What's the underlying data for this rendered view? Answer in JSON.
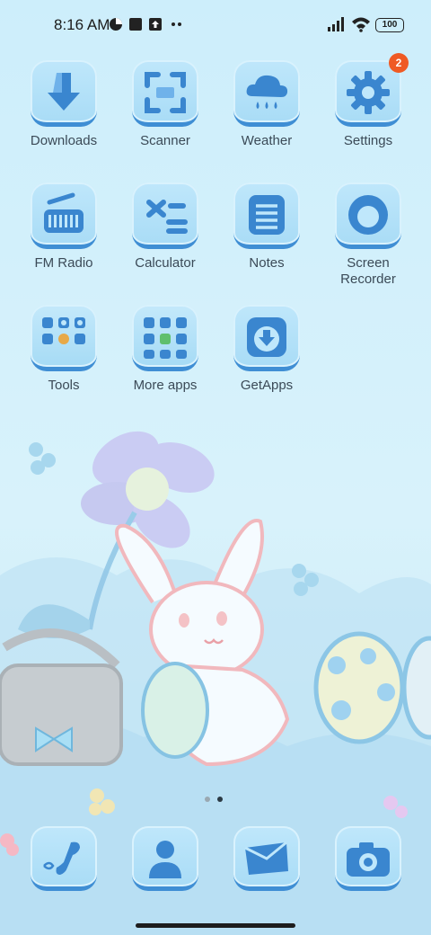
{
  "status_bar": {
    "time": "8:16 AM",
    "battery": "100",
    "icons": [
      "data-saver-icon",
      "square-notification-icon",
      "upload-notification-icon",
      "more-notifications-icon",
      "signal-icon",
      "wifi-icon",
      "battery-icon"
    ]
  },
  "apps": [
    {
      "label": "Downloads",
      "icon": "download-icon"
    },
    {
      "label": "Scanner",
      "icon": "scanner-icon"
    },
    {
      "label": "Weather",
      "icon": "weather-icon"
    },
    {
      "label": "Settings",
      "icon": "gear-icon",
      "badge": "2"
    },
    {
      "label": "FM Radio",
      "icon": "radio-icon"
    },
    {
      "label": "Calculator",
      "icon": "calculator-icon"
    },
    {
      "label": "Notes",
      "icon": "notes-icon"
    },
    {
      "label": "Screen\nRecorder",
      "icon": "screen-recorder-icon"
    },
    {
      "label": "Tools",
      "icon": "folder-icon"
    },
    {
      "label": "More apps",
      "icon": "folder-icon"
    },
    {
      "label": "GetApps",
      "icon": "getapps-icon"
    }
  ],
  "page_indicator": {
    "pages": 2,
    "current": 2
  },
  "dock": [
    {
      "icon": "phone-icon"
    },
    {
      "icon": "contacts-icon"
    },
    {
      "icon": "messages-icon"
    },
    {
      "icon": "camera-icon"
    }
  ],
  "colors": {
    "accent": "#3f8ed4",
    "badge": "#ef5a24",
    "tile": "#b3e0f8"
  }
}
